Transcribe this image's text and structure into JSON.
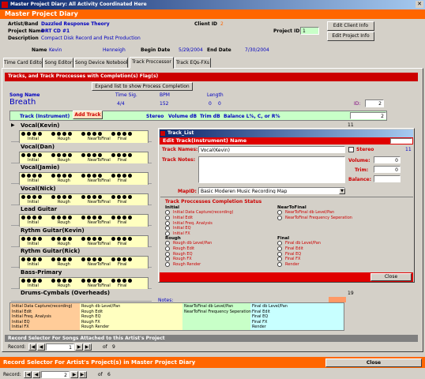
{
  "window": {
    "title": "Master Project Diary: All Activity Coordinated Here"
  },
  "header": {
    "title": "Master Project Diary"
  },
  "project": {
    "artist_label": "Artist/Band",
    "artist": "Dazzled Response Theory",
    "client_id_label": "Client ID",
    "client_id": "2",
    "project_name_label": "Project Name",
    "project_name": "DRT CD #1",
    "project_id_label": "Project ID",
    "project_id": "1",
    "description_label": "Description",
    "description": "Compact Disk Record and Post Production",
    "name_label": "Name",
    "first_name": "Kevin",
    "last_name": "Henneigh",
    "begin_label": "Begin Date",
    "begin_date": "5/29/2004",
    "end_label": "End Date",
    "end_date": "7/30/2004",
    "edit_client": "Edit Client Info",
    "edit_project": "Edit Project Info"
  },
  "tabs": [
    "Time Card Editor",
    "Song Editor",
    "Song Device Notebook",
    "Track Proccessor",
    "Track EQs-FXs"
  ],
  "panel": {
    "title": "Tracks, and Track Proccesses with Completion(s) Flag(s)",
    "expand_button": "Expand list to show Process Completion",
    "song_name_label": "Song Name",
    "time_sig_label": "Time Sig.",
    "bpm_label": "BPM",
    "length_label": "Length",
    "song_name": "Breath",
    "time_sig": "4/4",
    "bpm": "152",
    "length_min": "0",
    "length_sec": "0",
    "id_label": "ID:",
    "id": "2",
    "track_instrument_label": "Track (Instrument)",
    "add_track": "Add Track",
    "stereo_label": "Stereo",
    "volume_label": "Volume dB",
    "trim_label": "Trim dB",
    "balance_label": "Balance L%, C, or R%",
    "balance_value": "2",
    "row_id": "11"
  },
  "phases": [
    "Initial",
    "Rough",
    "NearToFinal",
    "Final"
  ],
  "tracks": [
    "Vocal(Kevin)",
    "Vocal(Dan)",
    "Vocal(Jamie)",
    "Vocal(Nick)",
    "Lead Guitar",
    "Rythm Guitar(Kevin)",
    "Rythm Guitar(Rick)",
    "Bass-Primary",
    "Drums-Cymbals (Overheads)"
  ],
  "last_row_id": "19",
  "notes_label": "Notes:",
  "summary": {
    "col1": [
      "Initial Data Capture(recording)",
      "Initial Edit",
      "Initial Freq. Analysis",
      "Initial EQ",
      "Initial FX"
    ],
    "col2": [
      "Rough db Level/Pan",
      "Rough Edit",
      "Rough EQ",
      "Rough FX",
      "Rough Render"
    ],
    "col3": [
      "NearToFinal db Level/Pan",
      "NearToFinal  Frequency Seperation"
    ],
    "col4": [
      "Final db Level/Pan",
      "Final Edit",
      "Final EQ",
      "Final FX",
      "Render"
    ]
  },
  "record_selector_inner": {
    "title": "Record Selector For Songs Attached to this Artist's Project",
    "record_label": "Record:",
    "current": "1",
    "of": "of",
    "total": "9"
  },
  "record_selector_outer": {
    "title": "Record Selector For Artist's Project(s) in  Master Project Diary",
    "close": "Close",
    "record_label": "Record:",
    "current": "2",
    "of": "of",
    "total": "6"
  },
  "dialog": {
    "window_title": "Track_List",
    "title": "Edit Track(Instrument) Name",
    "track_names_label": "Track Names:",
    "track_name": "Vocal(Kevin)",
    "stereo_label": "Stereo",
    "stereo_num": "11",
    "track_notes_label": "Track Notes:",
    "volume_label": "Volume:",
    "volume": "0",
    "trim_label": "Trim:",
    "trim": "0",
    "balance_label": "Balance:",
    "mapid_label": "MapID:",
    "mapid": "Basic Moderen Music Recording Map",
    "status_title": "Track Proccesses Completion Status",
    "initial_label": "Initial",
    "initial_items": [
      "Initial Data Capture(recording)",
      "Initial Edit",
      "Initial Freq. Analysis",
      "Initial EQ",
      "Initial FX"
    ],
    "rough_label": "Rough",
    "rough_items": [
      "Rough db Level/Pan",
      "Rough Edit",
      "Rough EQ",
      "Rough FX",
      "Rough Render"
    ],
    "near_label": "NearToFinal",
    "near_items": [
      "NearToFinal db Level/Pan",
      "NearToFinal  Frequency Seperation"
    ],
    "final_label": "Final",
    "final_items": [
      "Final db Level/Pan",
      "Final Edit",
      "Final EQ",
      "Final FX",
      "Render"
    ],
    "close": "Close"
  },
  "colors": {
    "orange": "#ff6600",
    "red": "#cc0000",
    "green": "#c8ffc8",
    "yellow": "#ffffc0",
    "blue": "#0000c0",
    "dialog_red": "#e00000"
  }
}
